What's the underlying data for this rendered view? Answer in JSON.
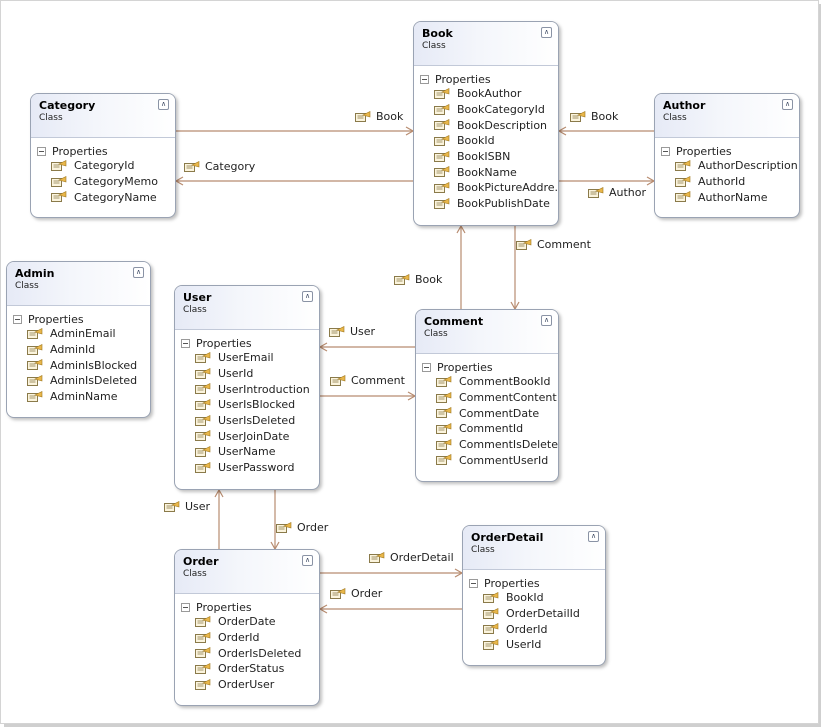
{
  "colors": {
    "connector": "#b88c70",
    "class_border": "#9aa3b3",
    "header_gradient_start": "#e6eaf6"
  },
  "section_label": "Properties",
  "classes": {
    "book": {
      "name": "Book",
      "kind": "Class",
      "properties": [
        "BookAuthor",
        "BookCategoryId",
        "BookDescription",
        "BookId",
        "BookISBN",
        "BookName",
        "BookPictureAddre...",
        "BookPublishDate"
      ]
    },
    "category": {
      "name": "Category",
      "kind": "Class",
      "properties": [
        "CategoryId",
        "CategoryMemo",
        "CategoryName"
      ]
    },
    "author": {
      "name": "Author",
      "kind": "Class",
      "properties": [
        "AuthorDescription",
        "AuthorId",
        "AuthorName"
      ]
    },
    "admin": {
      "name": "Admin",
      "kind": "Class",
      "properties": [
        "AdminEmail",
        "AdminId",
        "AdminIsBlocked",
        "AdminIsDeleted",
        "AdminName"
      ]
    },
    "user": {
      "name": "User",
      "kind": "Class",
      "properties": [
        "UserEmail",
        "UserId",
        "UserIntroduction",
        "UserIsBlocked",
        "UserIsDeleted",
        "UserJoinDate",
        "UserName",
        "UserPassword"
      ]
    },
    "comment": {
      "name": "Comment",
      "kind": "Class",
      "properties": [
        "CommentBookId",
        "CommentContent",
        "CommentDate",
        "CommentId",
        "CommentIsDeleted",
        "CommentUserId"
      ]
    },
    "order": {
      "name": "Order",
      "kind": "Class",
      "properties": [
        "OrderDate",
        "OrderId",
        "OrderIsDeleted",
        "OrderStatus",
        "OrderUser"
      ]
    },
    "orderdetail": {
      "name": "OrderDetail",
      "kind": "Class",
      "properties": [
        "BookId",
        "OrderDetailId",
        "OrderId",
        "UserId"
      ]
    }
  },
  "associations": {
    "category_book": "Book",
    "book_category": "Category",
    "author_book": "Book",
    "book_author": "Author",
    "book_comment": "Comment",
    "comment_book": "Book",
    "comment_user": "User",
    "user_comment": "Comment",
    "order_user": "User",
    "user_order": "Order",
    "order_orderdetail": "OrderDetail",
    "orderdetail_order": "Order"
  }
}
